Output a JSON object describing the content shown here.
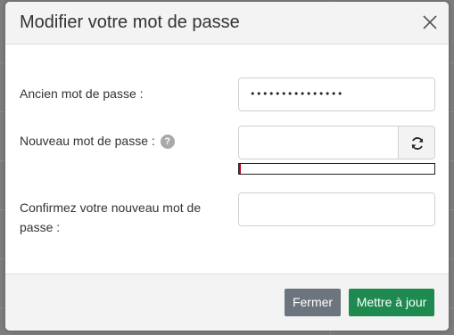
{
  "modal": {
    "title": "Modifier votre mot de passe"
  },
  "form": {
    "old_password": {
      "label": "Ancien mot de passe :",
      "value": "•••••••••••••••"
    },
    "new_password": {
      "label": "Nouveau mot de passe :",
      "help_glyph": "?",
      "value": "",
      "strength_fraction": 0.01
    },
    "confirm_password": {
      "label_line1": "Confirmez votre nouveau mot de",
      "label_line2": "passe :",
      "value": ""
    }
  },
  "footer": {
    "close_label": "Fermer",
    "update_label": "Mettre à jour"
  },
  "colors": {
    "update_button": "#1e8a4f",
    "close_button": "#6c757d",
    "strength_weak": "#c0001b"
  },
  "icons": {
    "close": "close-icon",
    "help": "help-icon",
    "refresh": "refresh-icon"
  }
}
